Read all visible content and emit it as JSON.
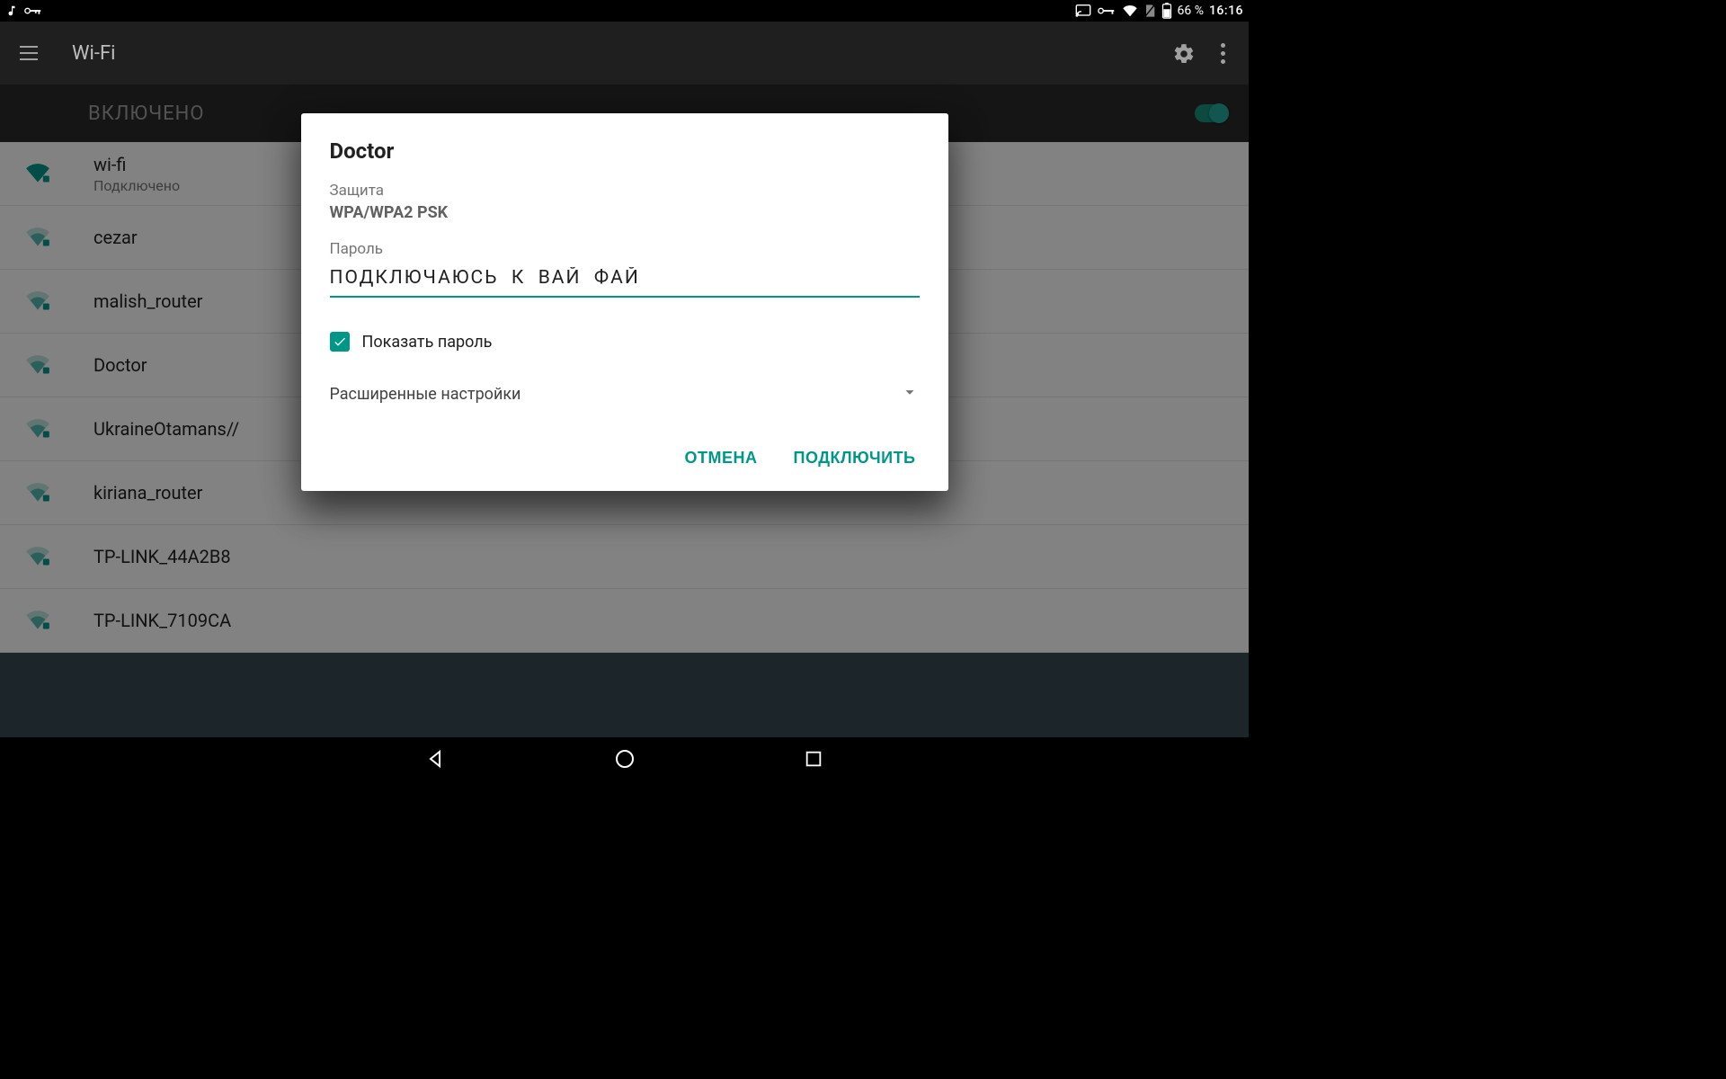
{
  "status": {
    "battery": "66 %",
    "time": "16:16"
  },
  "appbar": {
    "title": "Wi-Fi"
  },
  "toggle": {
    "label": "ВКЛЮЧЕНО"
  },
  "networks": [
    {
      "name": "wi-fi",
      "status": "Подключено",
      "level": 4
    },
    {
      "name": "cezar",
      "status": "",
      "level": 2
    },
    {
      "name": "malish_router",
      "status": "",
      "level": 2
    },
    {
      "name": "Doctor",
      "status": "",
      "level": 2
    },
    {
      "name": "UkraineOtamans//",
      "status": "",
      "level": 2
    },
    {
      "name": "kiriana_router",
      "status": "",
      "level": 2
    },
    {
      "name": "TP-LINK_44A2B8",
      "status": "",
      "level": 2
    },
    {
      "name": "TP-LINK_7109CA",
      "status": "",
      "level": 2
    }
  ],
  "dialog": {
    "title": "Doctor",
    "security_label": "Защита",
    "security_value": "WPA/WPA2 PSK",
    "password_label": "Пароль",
    "password_value": "ПОДКЛЮЧАЮСЬ  К  ВАЙ  ФАЙ",
    "show_password": "Показать пароль",
    "advanced": "Расширенные настройки",
    "cancel": "ОТМЕНА",
    "connect": "ПОДКЛЮЧИТЬ"
  }
}
